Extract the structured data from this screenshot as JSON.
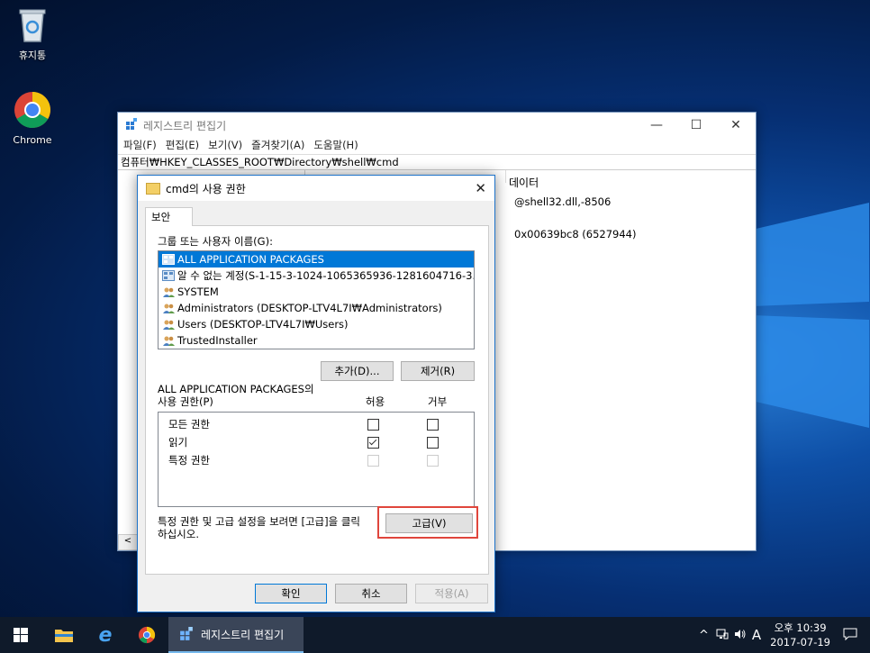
{
  "desktop": {
    "icons": [
      {
        "label": "휴지통",
        "icon": "recycle-bin-icon"
      },
      {
        "label": "Chrome",
        "icon": "chrome-icon"
      }
    ]
  },
  "regedit": {
    "title": "레지스트리 편집기",
    "controls": {
      "minimize": "—",
      "maximize": "☐",
      "close": "✕"
    },
    "menu": [
      "파일(F)",
      "편집(E)",
      "보기(V)",
      "즐겨찾기(A)",
      "도움말(H)"
    ],
    "address": "컴퓨터₩HKEY_CLASSES_ROOT₩Directory₩shell₩cmd",
    "column_data": "데이터",
    "values": [
      "@shell32.dll,-8506",
      "0x00639bc8 (6527944)"
    ],
    "scroll_left": "<"
  },
  "dialog": {
    "title": "cmd의 사용 권한",
    "close": "✕",
    "tab": "보안",
    "group_label": "그룹 또는 사용자 이름(G):",
    "users": [
      {
        "name": "ALL APPLICATION PACKAGES",
        "selected": true,
        "icon": "app-package-icon"
      },
      {
        "name": "알 수 없는 계정(S-1-15-3-1024-1065365936-1281604716-3...",
        "selected": false,
        "icon": "unknown-account-icon"
      },
      {
        "name": "SYSTEM",
        "selected": false,
        "icon": "user-group-icon"
      },
      {
        "name": "Administrators (DESKTOP-LTV4L7I₩Administrators)",
        "selected": false,
        "icon": "user-group-icon"
      },
      {
        "name": "Users (DESKTOP-LTV4L7I₩Users)",
        "selected": false,
        "icon": "user-group-icon"
      },
      {
        "name": "TrustedInstaller",
        "selected": false,
        "icon": "user-group-icon"
      }
    ],
    "add_button": "추가(D)...",
    "remove_button": "제거(R)",
    "perm_label_line1": "ALL APPLICATION PACKAGES의",
    "perm_label_line2": "사용 권한(P)",
    "allow_header": "허용",
    "deny_header": "거부",
    "permissions": [
      {
        "name": "모든 권한",
        "allow": false,
        "deny": false,
        "enabled": true
      },
      {
        "name": "읽기",
        "allow": true,
        "deny": false,
        "enabled": true
      },
      {
        "name": "특정 권한",
        "allow": false,
        "deny": false,
        "enabled": false
      }
    ],
    "advanced_text_line1": "특정 권한 및 고급 설정을 보려면 [고급]을 클릭",
    "advanced_text_line2": "하십시오.",
    "advanced_button": "고급(V)",
    "ok_button": "확인",
    "cancel_button": "취소",
    "apply_button": "적용(A)"
  },
  "taskbar": {
    "active_app": "레지스트리 편집기",
    "tray_lang": "A",
    "tray_chevron": "^",
    "clock_time": "오후 10:39",
    "clock_date": "2017-07-19"
  },
  "colors": {
    "accent": "#0078d7",
    "highlight_box": "#e0463c"
  }
}
